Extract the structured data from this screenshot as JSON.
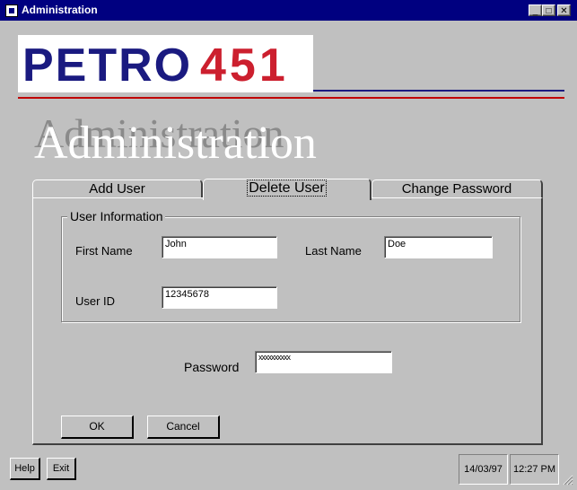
{
  "window": {
    "title": "Administration",
    "controls": {
      "minimize": "_",
      "maximize": "□",
      "close": "✕"
    }
  },
  "logo": {
    "text": "PETRO 451",
    "colors": {
      "petro": "#1a1a80",
      "number": "#cc1f2e"
    }
  },
  "heading": {
    "text": "Administration",
    "shadow_text": "Administration"
  },
  "tabs": [
    {
      "label": "Add User",
      "active": false
    },
    {
      "label": "Delete User",
      "active": true
    },
    {
      "label": "Change Password",
      "active": false
    }
  ],
  "user_info": {
    "group_title": "User Information",
    "first_name_label": "First Name",
    "first_name_value": "John",
    "last_name_label": "Last Name",
    "last_name_value": "Doe",
    "user_id_label": "User ID",
    "user_id_value": "12345678"
  },
  "password": {
    "label": "Password",
    "value": "xxxxxxxxxx"
  },
  "buttons": {
    "ok": "OK",
    "cancel": "Cancel"
  },
  "footer": {
    "help": "Help",
    "exit": "Exit",
    "date": "14/03/97",
    "time": "12:27 PM"
  },
  "colors": {
    "titlebar": "#000080",
    "face": "#c0c0c0",
    "rule_navy": "#1a1a80",
    "rule_red": "#c00000"
  }
}
